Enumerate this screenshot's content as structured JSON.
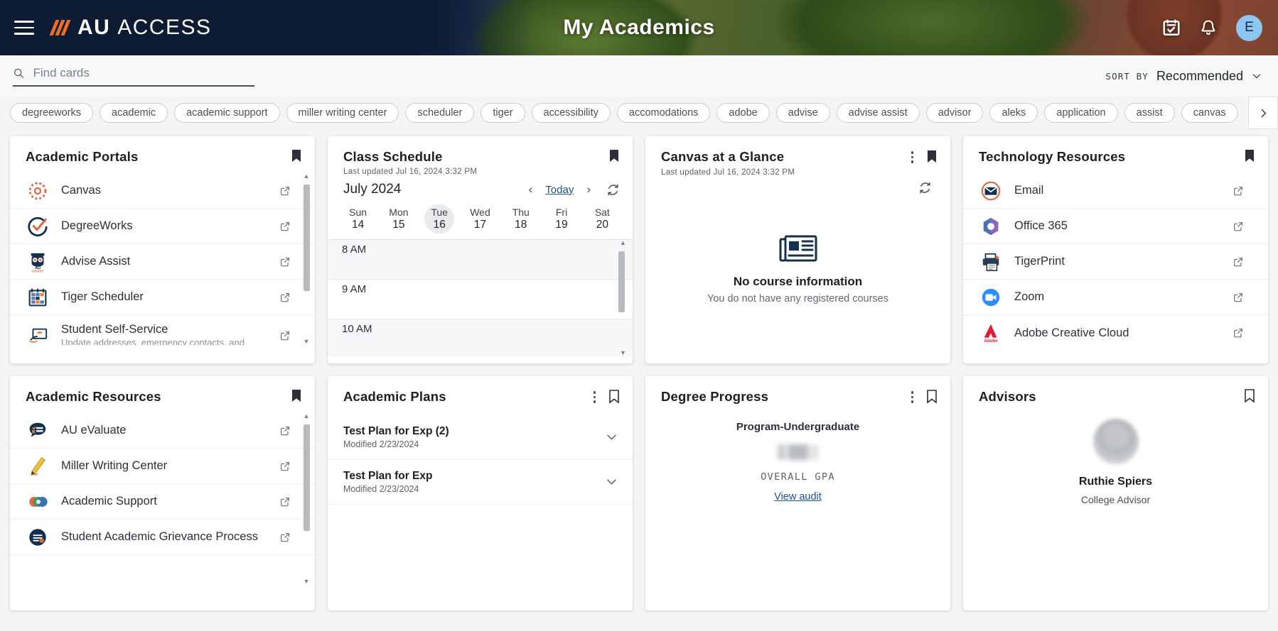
{
  "header": {
    "brand_bold": "AU",
    "brand_light": "ACCESS",
    "title": "My Academics",
    "avatar_initial": "E",
    "menu_icon": "hamburger-icon",
    "calendar_icon": "calendar-check-icon",
    "bell_icon": "notification-bell-icon"
  },
  "toolbar": {
    "search_placeholder": "Find cards",
    "search_value": "",
    "sort_by_label": "SORT BY",
    "sort_value": "Recommended"
  },
  "chips": [
    "degreeworks",
    "academic",
    "academic support",
    "miller writing center",
    "scheduler",
    "tiger",
    "accessibility",
    "accomodations",
    "adobe",
    "advise",
    "advise assist",
    "advisor",
    "aleks",
    "application",
    "assist",
    "canvas"
  ],
  "cards": {
    "academic_portals": {
      "title": "Academic Portals",
      "items": [
        {
          "label": "Canvas",
          "desc": "",
          "icon": "canvas-logo-icon"
        },
        {
          "label": "DegreeWorks",
          "desc": "",
          "icon": "degreeworks-logo-icon"
        },
        {
          "label": "Advise Assist",
          "desc": "",
          "icon": "advise-assist-owl-icon"
        },
        {
          "label": "Tiger Scheduler",
          "desc": "",
          "icon": "tiger-scheduler-calendar-icon"
        },
        {
          "label": "Student Self-Service",
          "desc": "Update addresses, emergency contacts, and",
          "icon": "student-self-service-icon"
        }
      ]
    },
    "class_schedule": {
      "title": "Class Schedule",
      "last_updated": "Last updated Jul 16, 2024 3:32 PM",
      "month": "July 2024",
      "today_label": "Today",
      "days": [
        {
          "name": "Sun",
          "num": "14",
          "active": false
        },
        {
          "name": "Mon",
          "num": "15",
          "active": false
        },
        {
          "name": "Tue",
          "num": "16",
          "active": true
        },
        {
          "name": "Wed",
          "num": "17",
          "active": false
        },
        {
          "name": "Thu",
          "num": "18",
          "active": false
        },
        {
          "name": "Fri",
          "num": "19",
          "active": false
        },
        {
          "name": "Sat",
          "num": "20",
          "active": false
        }
      ],
      "hours": [
        "8 AM",
        "9 AM",
        "10 AM"
      ]
    },
    "canvas_glance": {
      "title": "Canvas at a Glance",
      "last_updated": "Last updated Jul 16, 2024 3:32 PM",
      "empty_title": "No course information",
      "empty_text": "You do not have any registered courses"
    },
    "technology_resources": {
      "title": "Technology Resources",
      "items": [
        {
          "label": "Email",
          "icon": "email-envelope-icon"
        },
        {
          "label": "Office 365",
          "icon": "office365-logo-icon"
        },
        {
          "label": "TigerPrint",
          "icon": "printer-icon"
        },
        {
          "label": "Zoom",
          "icon": "zoom-video-icon"
        },
        {
          "label": "Adobe Creative Cloud",
          "icon": "adobe-logo-icon"
        }
      ]
    },
    "academic_resources": {
      "title": "Academic Resources",
      "items": [
        {
          "label": "AU eValuate",
          "icon": "evaluate-speech-bubble-icon"
        },
        {
          "label": "Miller Writing Center",
          "icon": "pencil-icon"
        },
        {
          "label": "Academic Support",
          "icon": "academic-support-icon"
        },
        {
          "label": "Student Academic Grievance Process",
          "icon": "grievance-icon"
        }
      ]
    },
    "academic_plans": {
      "title": "Academic Plans",
      "items": [
        {
          "name": "Test Plan for Exp (2)",
          "modified": "Modified 2/23/2024"
        },
        {
          "name": "Test Plan for Exp",
          "modified": "Modified 2/23/2024"
        }
      ]
    },
    "degree_progress": {
      "title": "Degree Progress",
      "program": "Program-Undergraduate",
      "gpa_label": "OVERALL GPA",
      "view_audit": "View audit"
    },
    "advisors": {
      "title": "Advisors",
      "name": "Ruthie Spiers",
      "role": "College Advisor"
    }
  },
  "colors": {
    "header_navy": "#0d1b33",
    "accent_orange": "#e86f25",
    "link_blue": "#1d4f91",
    "avatar_blue": "#8dc6f0"
  }
}
